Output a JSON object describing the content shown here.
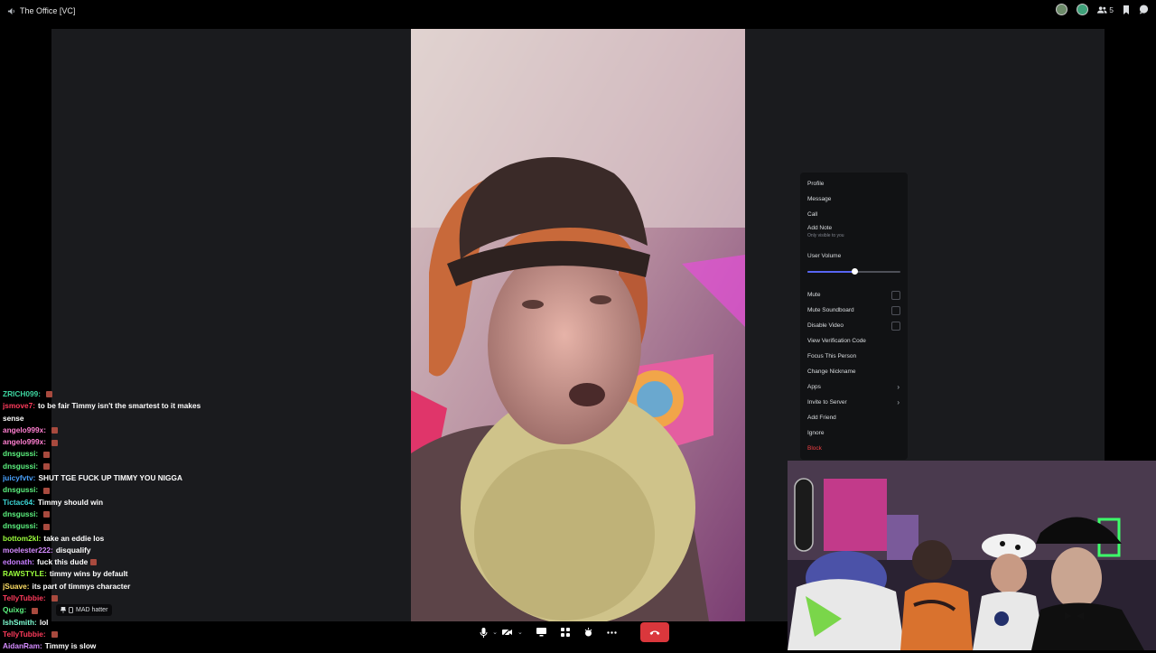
{
  "window": {
    "title": "The Office [VC]"
  },
  "topbar": {
    "member_count": "5"
  },
  "colors": {
    "accent": "#5865f2",
    "danger": "#f23f43",
    "end_call": "#da373c"
  },
  "context_menu": {
    "items": [
      {
        "label": "Profile"
      },
      {
        "label": "Message"
      },
      {
        "label": "Call"
      },
      {
        "label": "Add Note",
        "sub": "Only visible to you"
      }
    ],
    "volume": {
      "label": "User Volume",
      "value": 0.5
    },
    "toggles": [
      {
        "label": "Mute"
      },
      {
        "label": "Mute Soundboard"
      },
      {
        "label": "Disable Video"
      }
    ],
    "items2": [
      {
        "label": "View Verification Code"
      },
      {
        "label": "Focus This Person"
      },
      {
        "label": "Change Nickname"
      },
      {
        "label": "Apps",
        "submenu": true
      },
      {
        "label": "Invite to Server",
        "submenu": true
      },
      {
        "label": "Add Friend"
      },
      {
        "label": "Ignore"
      },
      {
        "label": "Block",
        "danger": true
      }
    ]
  },
  "chat": [
    {
      "user": "ZRICH099:",
      "color": "#3dd6a0",
      "msg": "",
      "emote": true
    },
    {
      "user": "jsmove7:",
      "color": "#ff3b5c",
      "msg": "to be fair Timmy isn't the smartest to it makes"
    },
    {
      "user": "",
      "color": "#fff",
      "msg": "sense"
    },
    {
      "user": "angelo999x:",
      "color": "#ff7fd0",
      "msg": "",
      "emote": true
    },
    {
      "user": "angelo999x:",
      "color": "#ff7fd0",
      "msg": "",
      "emote": true
    },
    {
      "user": "dnsgussi:",
      "color": "#5cf27f",
      "msg": "",
      "emote": true
    },
    {
      "user": "dnsgussi:",
      "color": "#5cf27f",
      "msg": "",
      "emote": true
    },
    {
      "user": "juicyfvtv:",
      "color": "#4aa3ff",
      "msg": "SHUT TGE FUCK UP TIMMY YOU NIGGA"
    },
    {
      "user": "dnsgussi:",
      "color": "#5cf27f",
      "msg": "",
      "emote": true
    },
    {
      "user": "Tictac64:",
      "color": "#3dd6d6",
      "msg": "Timmy should win"
    },
    {
      "user": "dnsgussi:",
      "color": "#5cf27f",
      "msg": "",
      "emote": true
    },
    {
      "user": "dnsgussi:",
      "color": "#5cf27f",
      "msg": "",
      "emote": true
    },
    {
      "user": "bottom2kl:",
      "color": "#9cff3d",
      "msg": "take an eddie los"
    },
    {
      "user": "moelester222:",
      "color": "#d58cff",
      "msg": "disqualify"
    },
    {
      "user": "edonath:",
      "color": "#c77dff",
      "msg": "fuck this dude",
      "emote": true
    },
    {
      "user": "RAWSTYLE:",
      "color": "#9cff3d",
      "msg": "timmy wins by default"
    },
    {
      "user": "jSuave:",
      "color": "#ffe066",
      "msg": "its part of timmys character"
    },
    {
      "user": "TellyTubbie:",
      "color": "#ff3b5c",
      "msg": "",
      "emote": true
    },
    {
      "user": "Quixg:",
      "color": "#5cf27f",
      "msg": "",
      "emote": true
    },
    {
      "user": "IshSmith:",
      "color": "#7fffd4",
      "msg": "lol"
    },
    {
      "user": "TellyTubbie:",
      "color": "#ff3b5c",
      "msg": "",
      "emote": true
    },
    {
      "user": "AidanRam:",
      "color": "#d58cff",
      "msg": "Timmy is slow"
    }
  ],
  "video_label": "MAD hatter",
  "controls": {
    "mic_icon": "microphone-icon",
    "camera_icon": "camera-off-icon",
    "screen_icon": "screen-share-icon",
    "activity_icon": "activities-icon",
    "soundboard_icon": "soundboard-icon",
    "more_icon": "more-icon",
    "end_icon": "end-call-icon"
  }
}
